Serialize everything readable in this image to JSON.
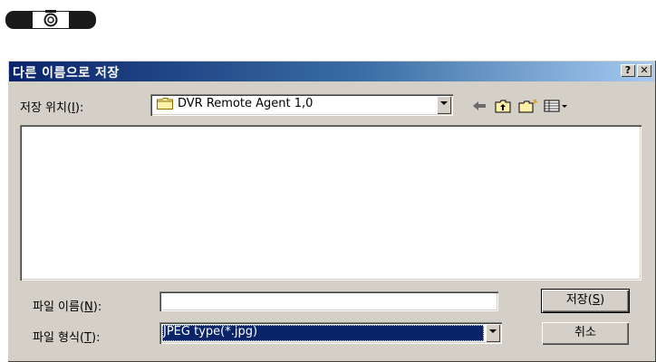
{
  "toolbar": {
    "snapshot_icon": "camera-icon"
  },
  "dialog": {
    "title": "다른 이름으로 저장",
    "help_label": "?",
    "close_label": "✕",
    "location": {
      "label_pre": "저장 위치(",
      "label_key": "I",
      "label_post": "):",
      "value": "DVR Remote Agent 1,0",
      "icon": "folder-icon"
    },
    "nav_icons": [
      "back-arrow-icon",
      "up-folder-icon",
      "new-folder-icon",
      "view-menu-icon"
    ],
    "filename": {
      "label_pre": "파일 이름(",
      "label_key": "N",
      "label_post": "):",
      "value": ""
    },
    "filetype": {
      "label_pre": "파일 형식(",
      "label_key": "T",
      "label_post": "):",
      "value": "JPEG type(*.jpg)"
    },
    "save_button": {
      "pre": "저장(",
      "key": "S",
      "post": ")"
    },
    "cancel_button": "취소"
  }
}
